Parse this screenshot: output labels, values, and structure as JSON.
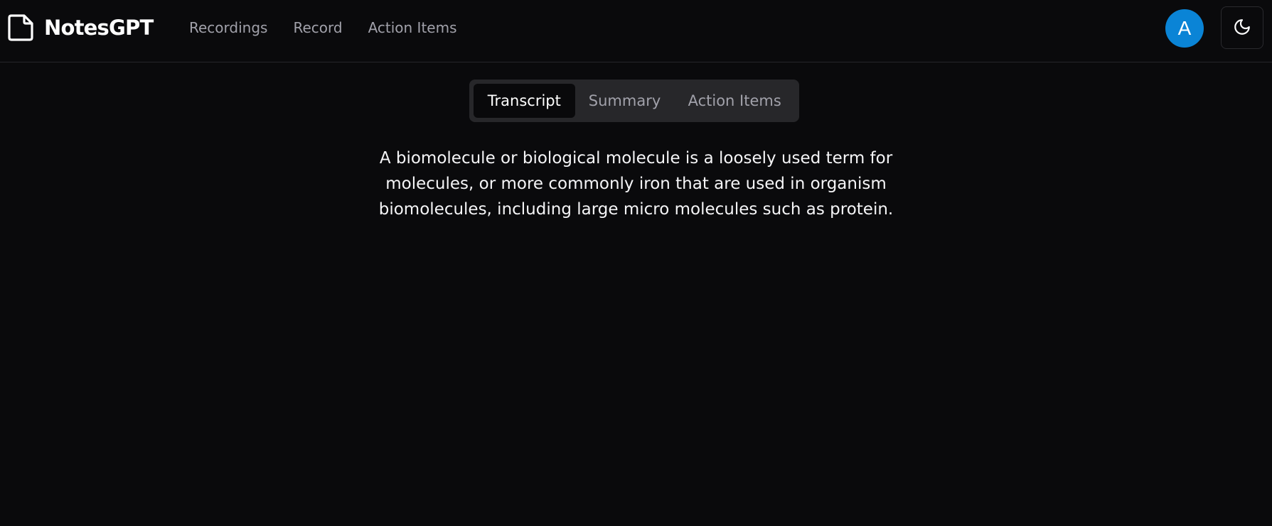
{
  "header": {
    "brand": "NotesGPT",
    "brand_icon": "file-icon",
    "nav": [
      {
        "label": "Recordings"
      },
      {
        "label": "Record"
      },
      {
        "label": "Action Items"
      }
    ],
    "avatar_initial": "A",
    "avatar_color": "#0a84d6",
    "theme_icon": "moon-icon"
  },
  "tabs": {
    "items": [
      {
        "label": "Transcript",
        "active": true
      },
      {
        "label": "Summary",
        "active": false
      },
      {
        "label": "Action Items",
        "active": false
      }
    ]
  },
  "content": {
    "transcript": "A biomolecule or biological molecule is a loosely used term for molecules, or more commonly iron that are used in organism biomolecules, including large micro molecules such as protein."
  }
}
